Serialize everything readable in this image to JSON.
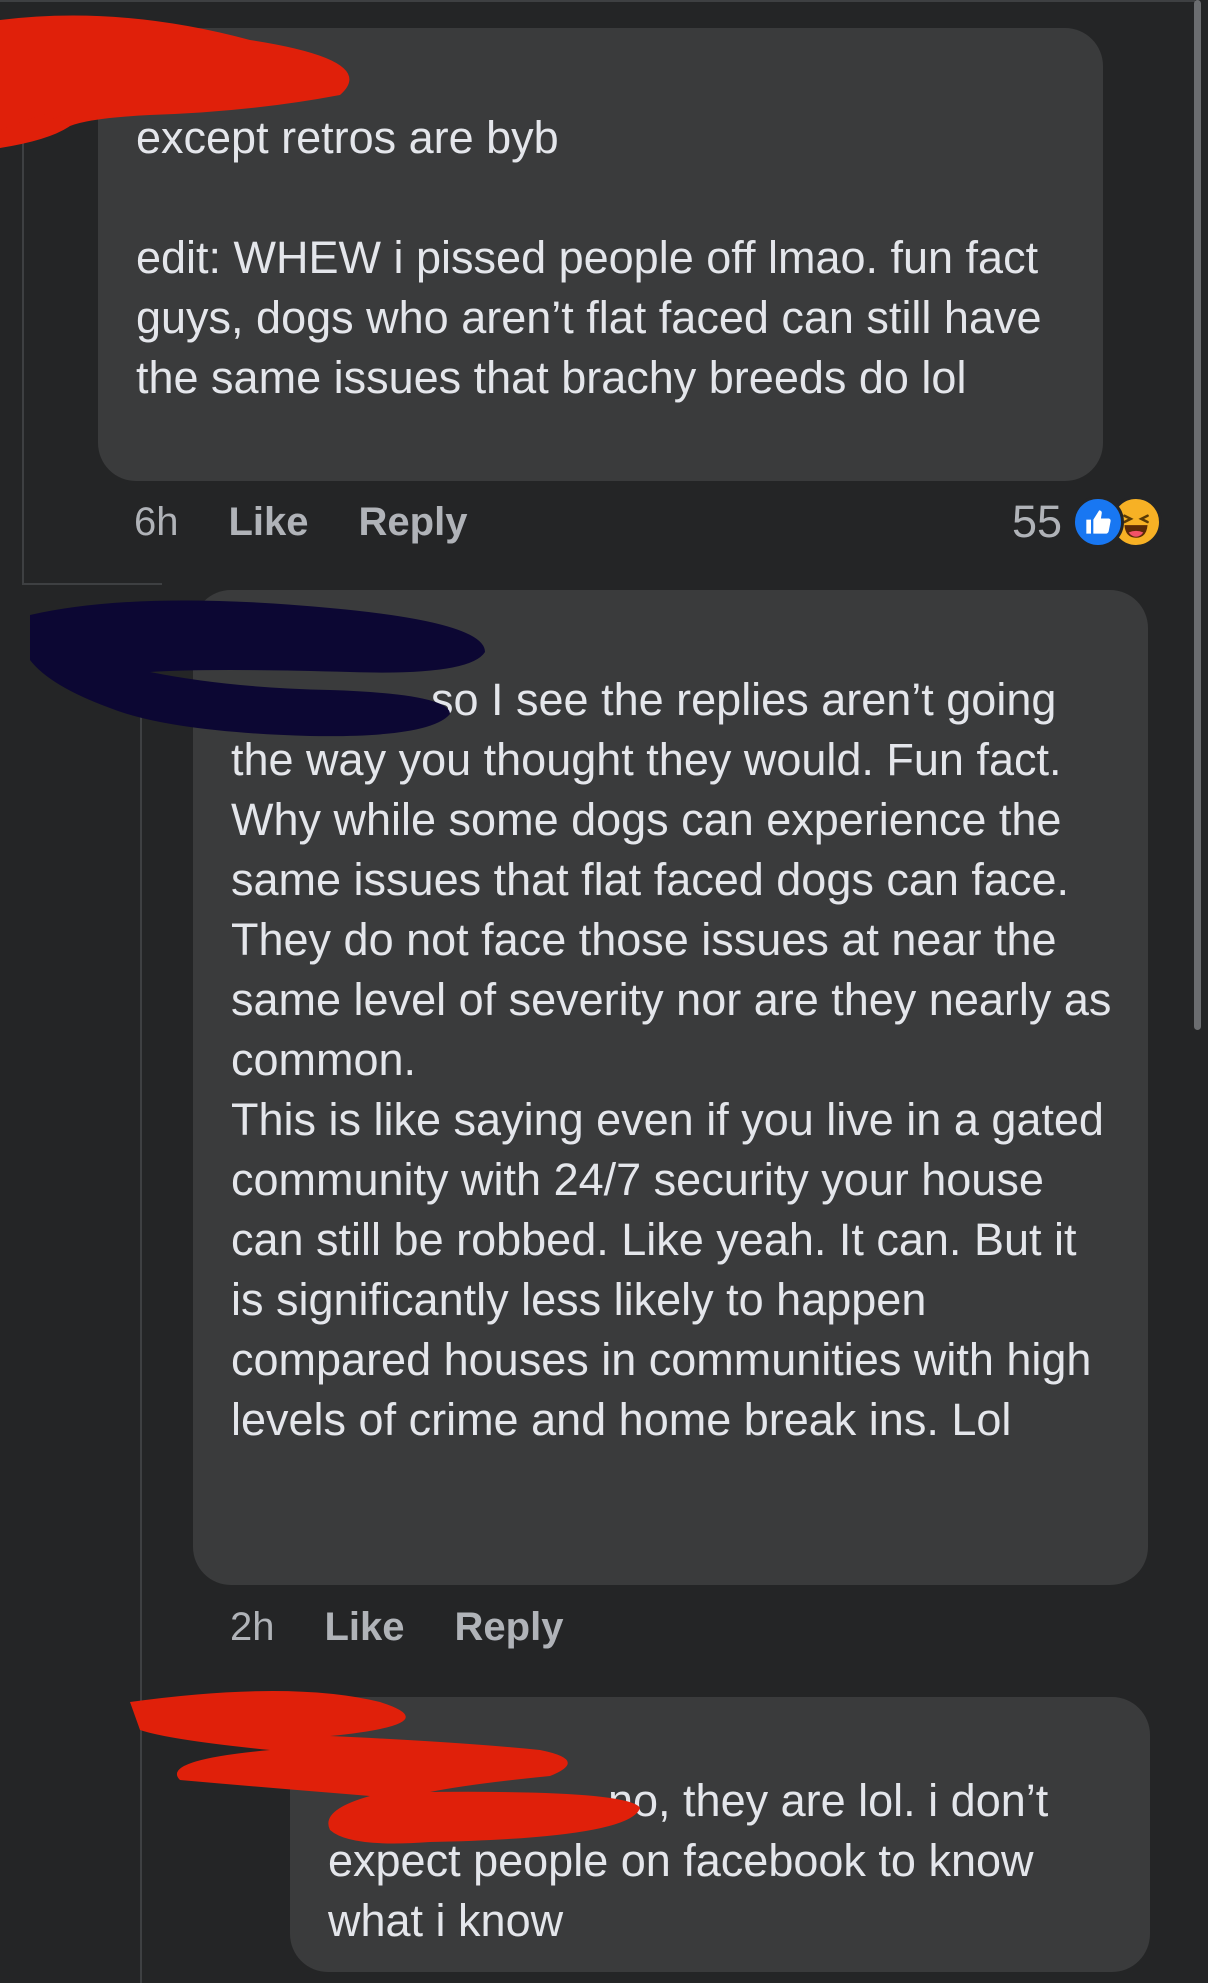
{
  "comments": [
    {
      "paragraphs": [
        "except retros are byb",
        "edit: WHEW i pissed people off lmao. fun fact guys, dogs who aren’t flat faced can still have the same issues that brachy breeds do lol"
      ],
      "time": "6h",
      "like_label": "Like",
      "reply_label": "Reply",
      "reaction_count": "55",
      "reactions": [
        "like-icon",
        "haha-icon"
      ]
    },
    {
      "paragraphs": [
        "so I see the replies aren’t going the way you thought they would. Fun fact. Why while some dogs can experience the same issues that flat faced dogs can face. They do not face those issues at near the same level of severity nor are they nearly as common.",
        "This is like saying even if you live in a gated community with 24/7 security your house can still be robbed. Like yeah. It can. But it is significantly less likely to happen compared houses in communities with high levels of crime and home break ins. Lol"
      ],
      "time": "2h",
      "like_label": "Like",
      "reply_label": "Reply"
    },
    {
      "paragraphs": [
        "no, they are lol. i don’t expect people on facebook to know what i know"
      ]
    }
  ],
  "colors": {
    "background": "#242526",
    "bubble": "#3a3b3c",
    "text": "#e4e6eb",
    "secondary_text": "#b0b3b8",
    "like_blue": "#1877f2",
    "redaction_red": "#e0200a",
    "redaction_navy": "#0c0733"
  }
}
